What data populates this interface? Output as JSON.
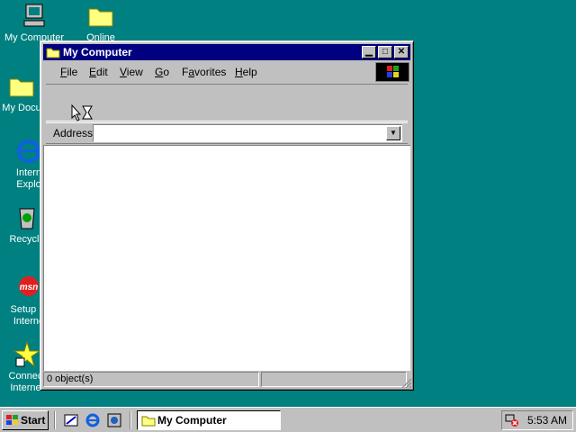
{
  "desktop": {
    "icons": [
      {
        "label": "My Computer"
      },
      {
        "label": "Online"
      },
      {
        "label": "My Docu"
      },
      {
        "label": "Intern",
        "label2": "Explo"
      },
      {
        "label": "Recycle"
      },
      {
        "label": "Setup M",
        "label2": "Interne"
      },
      {
        "label": "Connect",
        "label2": "Internet"
      }
    ]
  },
  "window": {
    "title": "My Computer",
    "menu": [
      "File",
      "Edit",
      "View",
      "Go",
      "Favorites",
      "Help"
    ],
    "menu_mnemonic": [
      "F",
      "E",
      "V",
      "G",
      "a",
      "H"
    ],
    "address_label": "Address",
    "address_value": "",
    "status_text": "0 object(s)"
  },
  "taskbar": {
    "start_label": "Start",
    "task_label": "My Computer",
    "clock": "5:53 AM"
  },
  "colors": {
    "desktop": "#008080",
    "titlebar": "#000080",
    "face": "#c0c0c0"
  }
}
